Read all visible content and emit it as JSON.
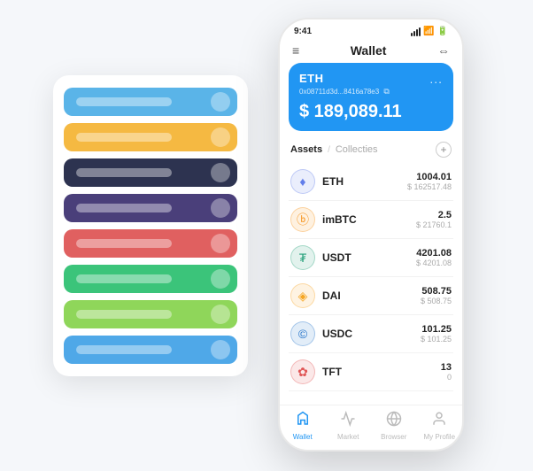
{
  "bg_card": {
    "rows": [
      {
        "color": "#5ab4e8",
        "label": "row1"
      },
      {
        "color": "#f5b942",
        "label": "row2"
      },
      {
        "color": "#2d3350",
        "label": "row3"
      },
      {
        "color": "#4a3f7a",
        "label": "row4"
      },
      {
        "color": "#e06060",
        "label": "row5"
      },
      {
        "color": "#3bc47a",
        "label": "row6"
      },
      {
        "color": "#8fd65a",
        "label": "row7"
      },
      {
        "color": "#4fa8e8",
        "label": "row8"
      }
    ]
  },
  "status_bar": {
    "time": "9:41",
    "battery": "█",
    "wifi": "wifi",
    "signal": "signal"
  },
  "nav": {
    "menu_icon": "≡",
    "title": "Wallet",
    "expand_icon": "⇔"
  },
  "eth_card": {
    "currency": "ETH",
    "address": "0x08711d3d...8416a78e3",
    "copy_icon": "⧉",
    "amount": "$ 189,089.11",
    "menu_icon": "..."
  },
  "assets": {
    "tab_active": "Assets",
    "tab_divider": "/",
    "tab_inactive": "Collecties",
    "add_icon": "+",
    "items": [
      {
        "symbol": "ETH",
        "icon_char": "♦",
        "icon_color": "#627EEA",
        "amount": "1004.01",
        "usd": "$ 162517.48"
      },
      {
        "symbol": "imBTC",
        "icon_char": "ⓑ",
        "icon_color": "#F7931A",
        "amount": "2.5",
        "usd": "$ 21760.1"
      },
      {
        "symbol": "USDT",
        "icon_char": "₮",
        "icon_color": "#26A17B",
        "amount": "4201.08",
        "usd": "$ 4201.08"
      },
      {
        "symbol": "DAI",
        "icon_char": "◈",
        "icon_color": "#F5A623",
        "amount": "508.75",
        "usd": "$ 508.75"
      },
      {
        "symbol": "USDC",
        "icon_char": "©",
        "icon_color": "#2775CA",
        "amount": "101.25",
        "usd": "$ 101.25"
      },
      {
        "symbol": "TFT",
        "icon_char": "✿",
        "icon_color": "#e05555",
        "amount": "13",
        "usd": "0"
      }
    ]
  },
  "bottom_nav": {
    "items": [
      {
        "label": "Wallet",
        "icon": "◎",
        "active": true
      },
      {
        "label": "Market",
        "icon": "📈",
        "active": false
      },
      {
        "label": "Browser",
        "icon": "🌐",
        "active": false
      },
      {
        "label": "My Profile",
        "icon": "👤",
        "active": false
      }
    ]
  }
}
